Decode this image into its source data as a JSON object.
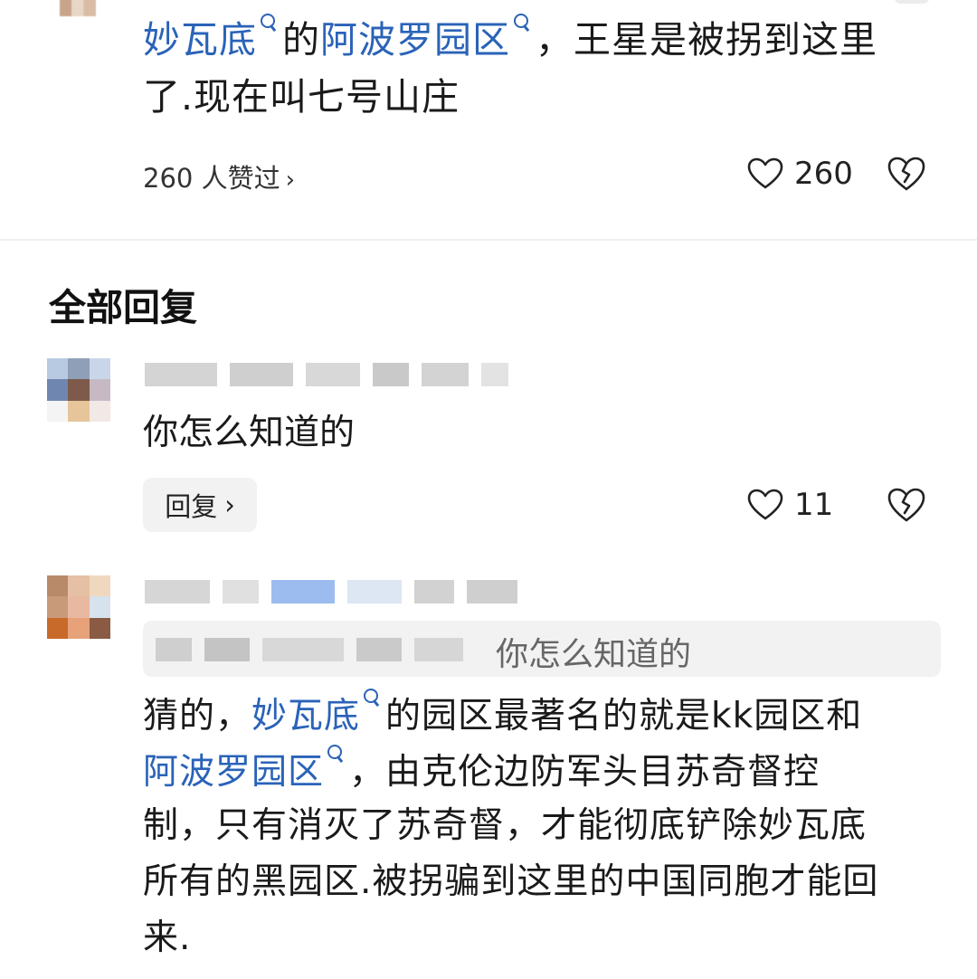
{
  "top_comment": {
    "line1": {
      "link1": "妙瓦底",
      "text1": "的",
      "link2": "阿波罗园区",
      "text2": "，王星是被拐到这里"
    },
    "line2": "了.现在叫七号山庄",
    "likes_label": "260 人赞过",
    "likes_chevron": "›",
    "like_count": "260"
  },
  "section_title": "全部回复",
  "replies": [
    {
      "text": "你怎么知道的",
      "reply_button": "回复",
      "reply_chevron": "›",
      "like_count": "11"
    },
    {
      "quoted_text": "你怎么知道的",
      "line1": {
        "text1": "猜的，",
        "link1": "妙瓦底",
        "text2": "的园区最著名的就是kk园区和"
      },
      "line2": {
        "link1": "阿波罗园区",
        "text1": "，由克伦边防军头目苏奇督控"
      },
      "line3": "制，只有消灭了苏奇督，才能彻底铲除妙瓦底",
      "line4": "所有的黑园区.被拐骗到这里的中国同胞才能回",
      "line5": "来."
    }
  ],
  "colors": {
    "link": "#2a63b8",
    "text": "#1a1a1a",
    "muted": "#666666",
    "button_bg": "#f2f2f2"
  },
  "icons": [
    "search-icon",
    "heart-icon",
    "broken-heart-icon",
    "chevron-right-icon"
  ]
}
